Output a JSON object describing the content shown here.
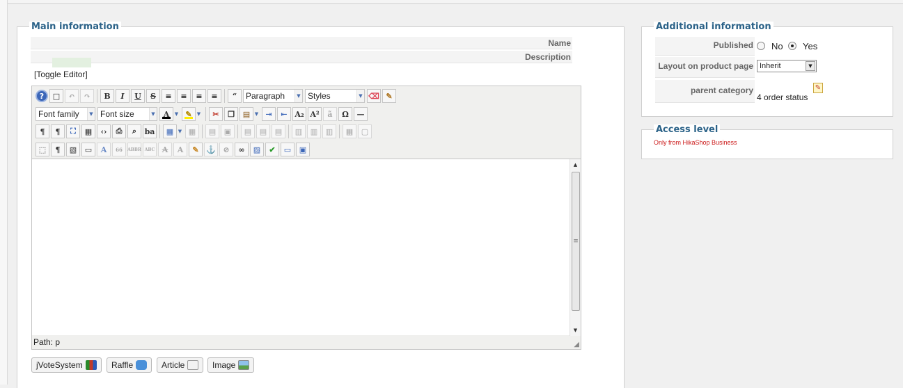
{
  "main": {
    "legend": "Main information",
    "name_label": "Name",
    "description_label": "Description",
    "toggle_editor": "[Toggle Editor]"
  },
  "editor": {
    "toolbar": {
      "paragraph": "Paragraph",
      "styles": "Styles",
      "font_family": "Font family",
      "font_size": "Font size"
    },
    "status_path": "Path:  p"
  },
  "buttons": [
    {
      "label": "jVoteSystem",
      "icon": "bar-chart-icon"
    },
    {
      "label": "Raffle",
      "icon": "raffle-icon"
    },
    {
      "label": "Article",
      "icon": "article-icon"
    },
    {
      "label": "Image",
      "icon": "image-icon"
    }
  ],
  "additional": {
    "legend": "Additional information",
    "published_label": "Published",
    "published_options": [
      "No",
      "Yes"
    ],
    "published_value": "Yes",
    "layout_label": "Layout on product page",
    "layout_value": "Inherit",
    "parent_label": "parent category",
    "parent_value": "4 order status"
  },
  "access": {
    "legend": "Access level",
    "note": "Only from HikaShop Business"
  },
  "colors": {
    "legend_blue": "#2b6288",
    "note_red": "#cc1a1a"
  }
}
